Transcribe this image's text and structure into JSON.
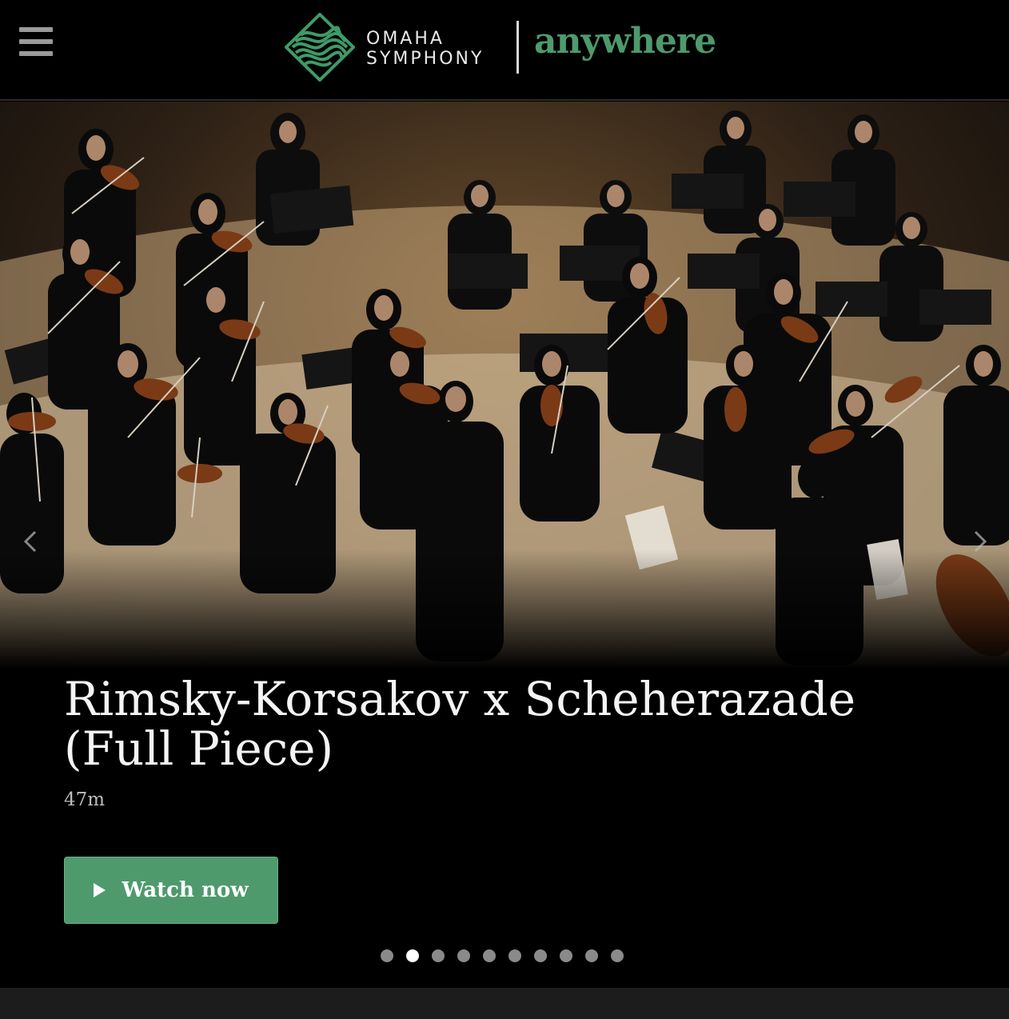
{
  "header": {
    "menu_icon": "hamburger-icon",
    "logo": {
      "line1": "OMAHA",
      "line2": "SYMPHONY",
      "product": "anywhere",
      "brand_color": "#4e9a6d"
    }
  },
  "hero": {
    "image_alt": "",
    "title": "Rimsky-Korsakov x Scheherazade (Full Piece)",
    "duration": "47m",
    "watch_label": "Watch now",
    "prev_icon": "chevron-left-icon",
    "next_icon": "chevron-right-icon",
    "slides_total": 10,
    "active_slide": 2
  },
  "colors": {
    "background": "#000000",
    "accent": "#4e9a6d",
    "dot_inactive": "#8a8a8a",
    "dot_active": "#ffffff"
  }
}
